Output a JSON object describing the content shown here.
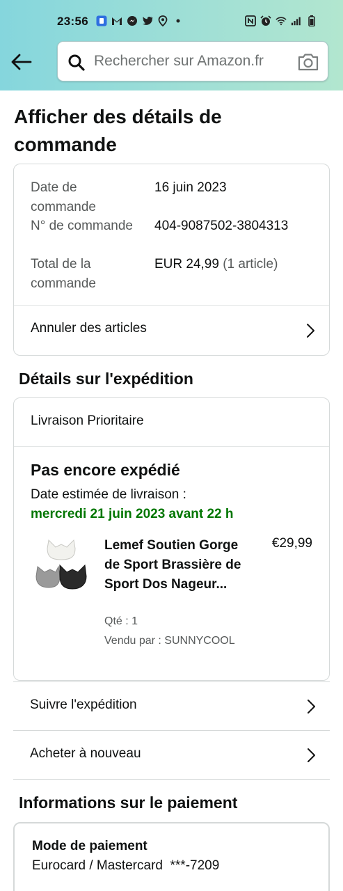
{
  "status_bar": {
    "time": "23:56",
    "left_icons": [
      "app-icon",
      "gmail-icon",
      "messenger-icon",
      "twitter-icon",
      "location-icon",
      "dot-icon"
    ],
    "right_icons": [
      "nfc-icon",
      "alarm-icon",
      "wifi-icon",
      "signal-icon",
      "battery-icon"
    ]
  },
  "header": {
    "back_icon": "arrow-left-icon",
    "search_placeholder": "Rechercher sur Amazon.fr",
    "camera_icon": "camera-icon",
    "gradient_colors": [
      "#85d6dd",
      "#b2e6cf"
    ]
  },
  "page_title": "Afficher des détails de commande",
  "order_summary": {
    "rows": [
      {
        "label": "Date de commande",
        "value": "16 juin 2023"
      },
      {
        "label": "N° de commande",
        "value": "404-9087502-3804313"
      },
      {
        "label": "Total de la commande",
        "value": "EUR 24,99",
        "suffix": "(1 article)"
      }
    ],
    "cancel_link": "Annuler des articles"
  },
  "shipping": {
    "section_title": "Détails sur l'expédition",
    "delivery_type": "Livraison Prioritaire",
    "status": "Pas encore expédié",
    "estimate_label": "Date estimée de livraison :",
    "estimate_date": "mercredi 21 juin 2023 avant 22 h",
    "estimate_color": "#007600",
    "product": {
      "title": "Lemef Soutien Gorge de Sport Brassière de Sport Dos Nageur...",
      "price": "€29,99",
      "qty": "Qté : 1",
      "seller": "Vendu par : SUNNYCOOL"
    },
    "track_link": "Suivre l'expédition",
    "buy_again_link": "Acheter à nouveau"
  },
  "payment": {
    "section_title": "Informations sur le paiement",
    "method_label": "Mode de paiement",
    "method_value": "Eurocard / Mastercard  ***-7209"
  }
}
